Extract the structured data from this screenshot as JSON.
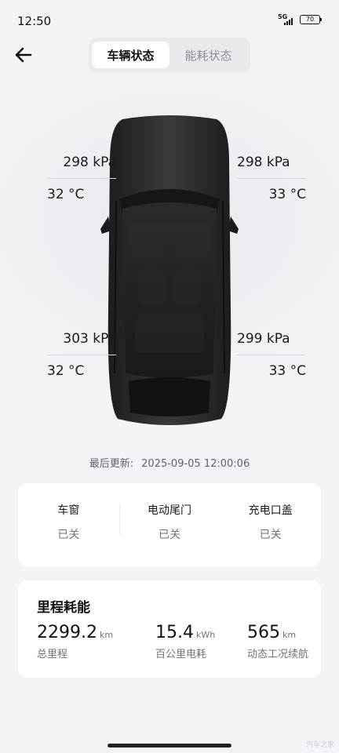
{
  "status_bar": {
    "time": "12:50",
    "network": "5G",
    "battery": "70"
  },
  "header": {
    "back_icon": "arrow-left-icon",
    "tabs": [
      {
        "label": "车辆状态",
        "active": true
      },
      {
        "label": "能耗状态",
        "active": false
      }
    ]
  },
  "tires": {
    "front_left": {
      "pressure": "298 kPa",
      "temperature": "32 °C"
    },
    "front_right": {
      "pressure": "298 kPa",
      "temperature": "33 °C"
    },
    "rear_left": {
      "pressure": "303 kPa",
      "temperature": "32 °C"
    },
    "rear_right": {
      "pressure": "299 kPa",
      "temperature": "33 °C"
    }
  },
  "last_update": {
    "label": "最后更新:",
    "value": "2025-09-05 12:00:06"
  },
  "vehicle_status": [
    {
      "label": "车窗",
      "value": "已关"
    },
    {
      "label": "电动尾门",
      "value": "已关"
    },
    {
      "label": "充电口盖",
      "value": "已关"
    }
  ],
  "mileage": {
    "title": "里程耗能",
    "metrics": [
      {
        "value": "2299.2",
        "unit": "km",
        "caption": "总里程"
      },
      {
        "value": "15.4",
        "unit": "kWh",
        "caption": "百公里电耗"
      },
      {
        "value": "565",
        "unit": "km",
        "caption": "动态工况续航"
      }
    ]
  },
  "watermark": "汽车之家",
  "colors": {
    "background": "#f3f4f7",
    "card": "#ffffff",
    "active_tab": "#ffffff",
    "inactive_text": "#8a8d94",
    "car_body": "#2b2b2b"
  }
}
